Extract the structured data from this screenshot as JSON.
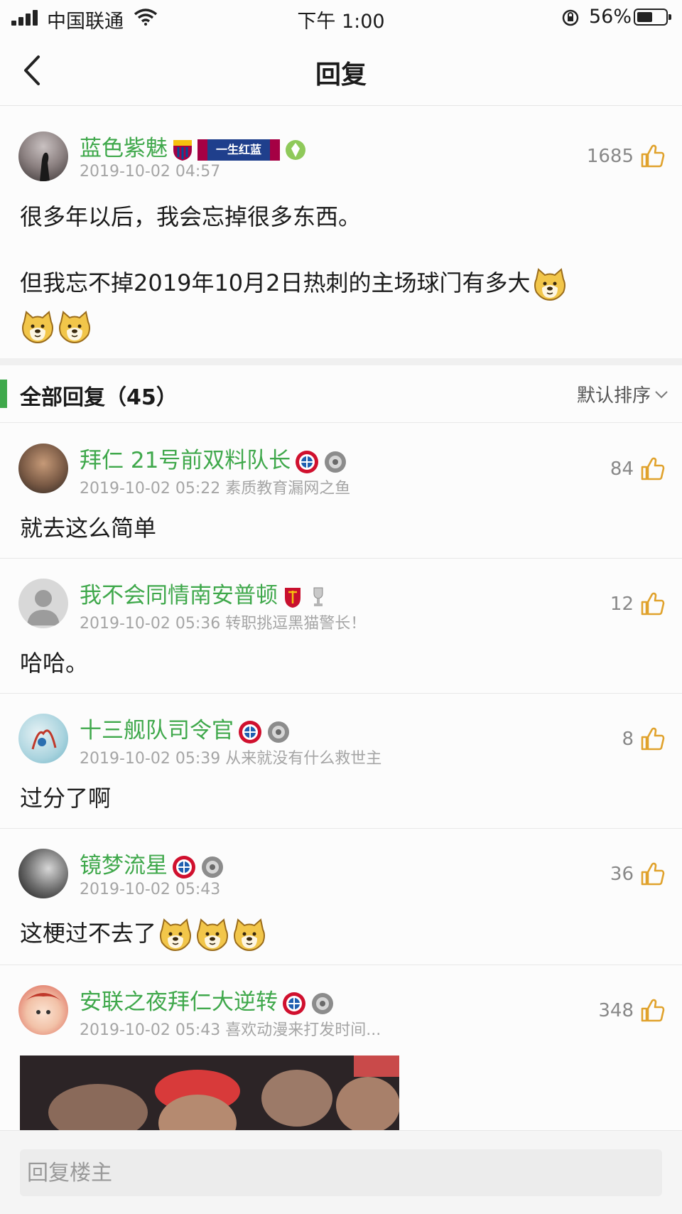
{
  "status_bar": {
    "carrier": "中国联通",
    "time": "下午 1:00",
    "battery": "56%",
    "battery_level": 0.56
  },
  "nav": {
    "title": "回复",
    "back_icon": "chevron-left-icon"
  },
  "main_post": {
    "username": "蓝色紫魅",
    "badges": [
      "barcelona-crest-icon",
      "banner-badge",
      "level-icon"
    ],
    "banner_text": "一生红蓝",
    "time": "2019-10-02 04:57",
    "likes": "1685",
    "line1": "很多年以后，我会忘掉很多东西。",
    "line2": "但我忘不掉2019年10月2日热刺的主场球门有多大"
  },
  "replies_header": {
    "label": "全部回复（45）",
    "sort": "默认排序"
  },
  "replies": [
    {
      "username": "拜仁 21号前双料队长",
      "meta": "2019-10-02 05:22 素质教育漏网之鱼",
      "likes": "84",
      "text": "就去这么简单"
    },
    {
      "username": "我不会同情南安普顿",
      "meta": "2019-10-02 05:36 转职挑逗黑猫警长！",
      "likes": "12",
      "text": "哈哈。"
    },
    {
      "username": "十三舰队司令官",
      "meta": "2019-10-02 05:39 从来就没有什么救世主",
      "likes": "8",
      "text": "过分了啊"
    },
    {
      "username": "镜梦流星",
      "meta": "2019-10-02 05:43",
      "likes": "36",
      "text": "这梗过不去了"
    },
    {
      "username": "安联之夜拜仁大逆转",
      "meta": "2019-10-02 05:43 喜欢动漫来打发时间...",
      "likes": "348"
    }
  ],
  "reply_bar": {
    "placeholder": "回复楼主"
  },
  "colors": {
    "accent": "#3fa84b",
    "text": "#1b1b1b",
    "muted": "#a5a5a5"
  }
}
